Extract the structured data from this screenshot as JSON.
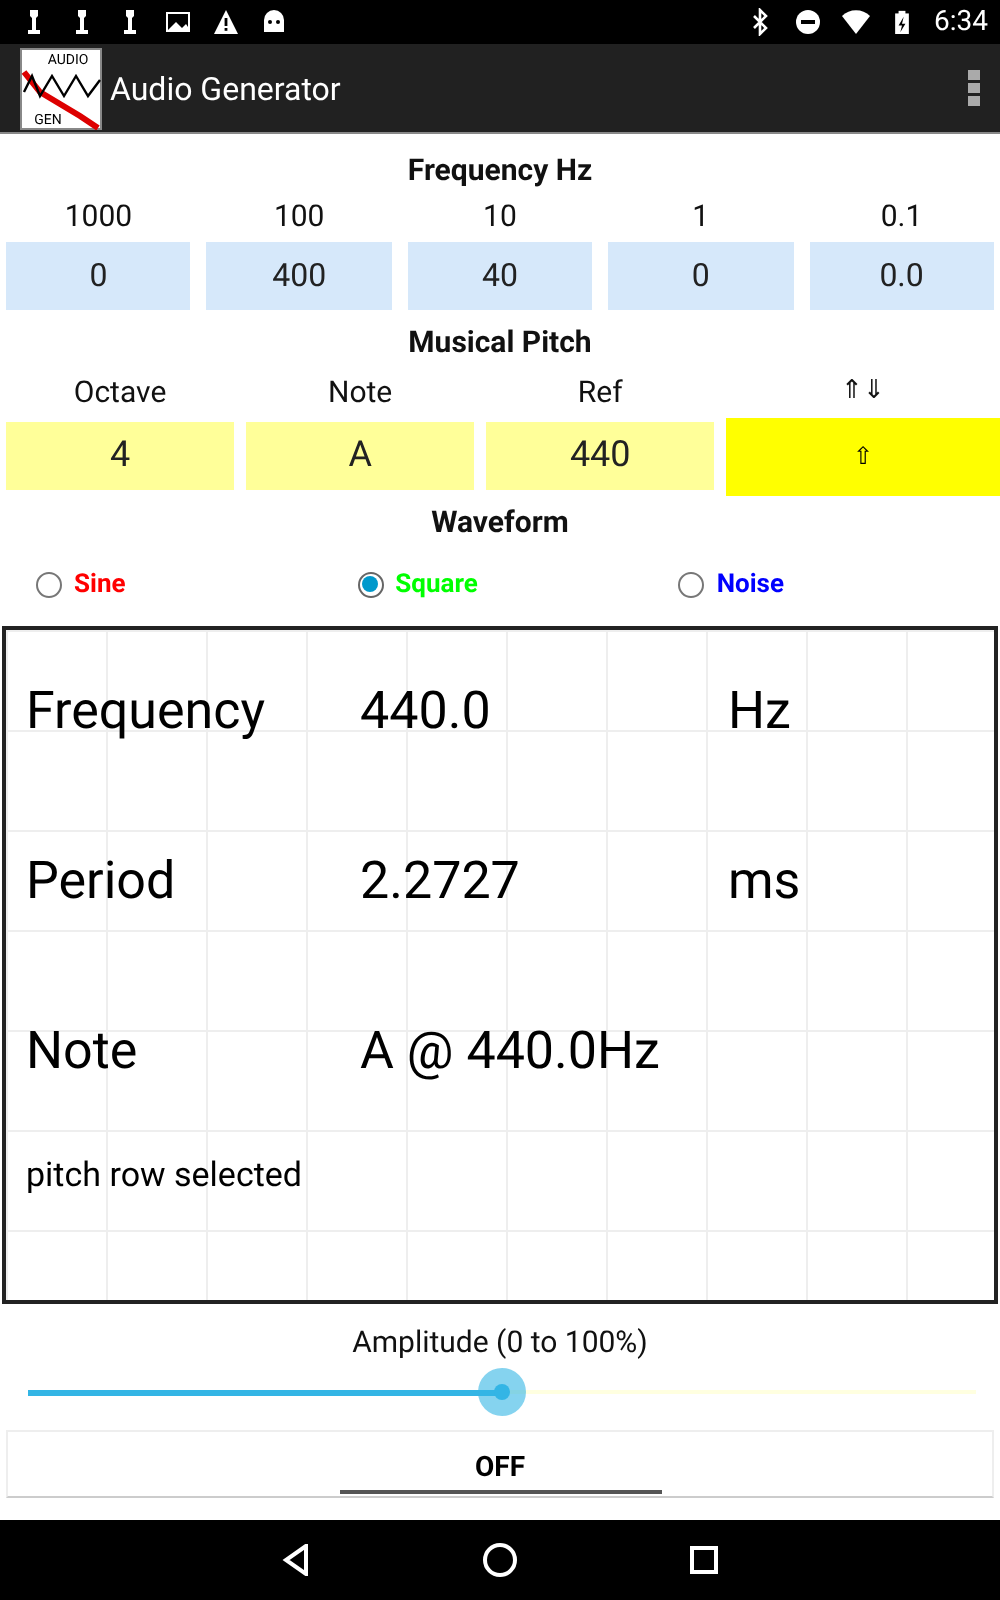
{
  "status_bar": {
    "time": "6:34"
  },
  "app_bar": {
    "logo_text": [
      "AUDIO",
      "GEN"
    ],
    "title": "Audio Generator"
  },
  "frequency": {
    "title": "Frequency Hz",
    "columns": [
      {
        "label": "1000",
        "value": "0"
      },
      {
        "label": "100",
        "value": "400"
      },
      {
        "label": "10",
        "value": "40"
      },
      {
        "label": "1",
        "value": "0"
      },
      {
        "label": "0.1",
        "value": "0.0"
      }
    ]
  },
  "musical_pitch": {
    "title": "Musical Pitch",
    "columns": [
      {
        "label": "Octave",
        "value": "4",
        "kind": "field"
      },
      {
        "label": "Note",
        "value": "A",
        "kind": "field"
      },
      {
        "label": "Ref",
        "value": "440",
        "kind": "field"
      },
      {
        "label": "⇑⇓",
        "value": "⇧",
        "kind": "toggle"
      }
    ]
  },
  "waveform": {
    "title": "Waveform",
    "options": [
      {
        "label": "Sine",
        "selected": false,
        "color": "#ff0000"
      },
      {
        "label": "Square",
        "selected": true,
        "color": "#00ff00"
      },
      {
        "label": "Noise",
        "selected": false,
        "color": "#0000ff"
      }
    ]
  },
  "display": {
    "rows": [
      {
        "name": "Frequency",
        "value": "440.0",
        "unit": "Hz"
      },
      {
        "name": "Period",
        "value": "2.2727",
        "unit": "ms"
      },
      {
        "name": "Note",
        "value": "A @ 440.0Hz"
      }
    ],
    "message": "pitch row selected"
  },
  "amplitude": {
    "label": "Amplitude (0 to 100%)",
    "level": 0.5
  },
  "power_button": {
    "label": "OFF"
  }
}
